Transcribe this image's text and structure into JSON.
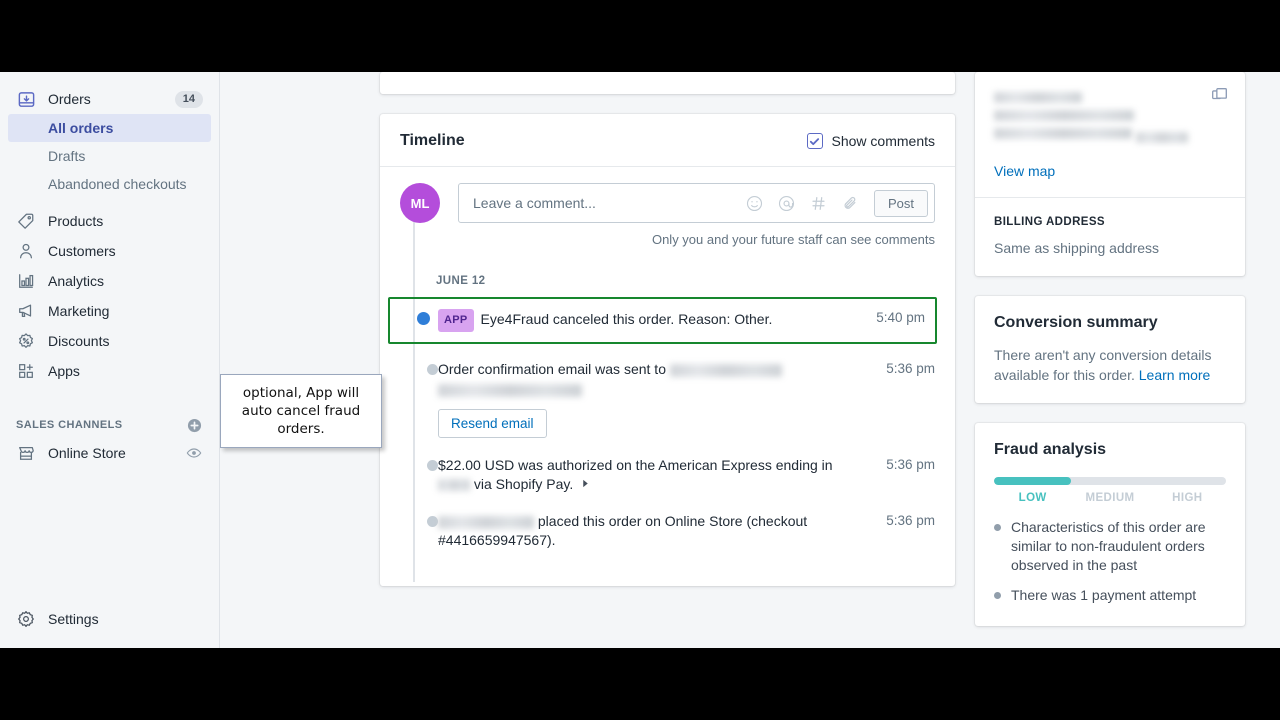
{
  "sidebar": {
    "orders": {
      "label": "Orders",
      "badge": "14",
      "icon": "orders-icon"
    },
    "sub_items": [
      {
        "label": "All orders",
        "active": true
      },
      {
        "label": "Drafts",
        "active": false
      },
      {
        "label": "Abandoned checkouts",
        "active": false
      }
    ],
    "items": [
      {
        "label": "Products",
        "icon": "tag-icon"
      },
      {
        "label": "Customers",
        "icon": "person-icon"
      },
      {
        "label": "Analytics",
        "icon": "bar-chart-icon"
      },
      {
        "label": "Marketing",
        "icon": "megaphone-icon"
      },
      {
        "label": "Discounts",
        "icon": "percent-badge-icon"
      },
      {
        "label": "Apps",
        "icon": "apps-grid-icon"
      }
    ],
    "sales_channels": {
      "label": "SALES CHANNELS",
      "add_icon": "plus-circle-icon",
      "channels": [
        {
          "label": "Online Store",
          "icon": "storefront-icon",
          "trailing_icon": "eye-icon"
        }
      ]
    },
    "settings": {
      "label": "Settings",
      "icon": "gear-icon"
    }
  },
  "timeline": {
    "title": "Timeline",
    "show_comments_label": "Show comments",
    "show_comments_checked": true,
    "avatar_initials": "ML",
    "comment_placeholder": "Leave a comment...",
    "post_label": "Post",
    "privacy_note": "Only you and your future staff can see comments",
    "comment_icons": [
      "emoji-icon",
      "mention-icon",
      "hashtag-icon",
      "attachment-icon"
    ],
    "date_group": "JUNE 12",
    "events": [
      {
        "id": "fraud-cancel",
        "highlighted": true,
        "badge": "APP",
        "text": "Eye4Fraud canceled this order. Reason: Other.",
        "time": "5:40 pm"
      },
      {
        "id": "order-confirmation",
        "highlighted": false,
        "text_before": "Order confirmation email was sent to",
        "redacted": true,
        "button": "Resend email",
        "time": "5:36 pm"
      },
      {
        "id": "payment-authorized",
        "highlighted": false,
        "text_before": "$22.00 USD was authorized on the American Express ending in",
        "text_after": "via Shopify Pay.",
        "redacted": true,
        "time": "5:36 pm"
      },
      {
        "id": "order-placed",
        "highlighted": false,
        "text_after": "placed this order on Online Store (checkout #4416659947567).",
        "redacted": true,
        "time": "5:36 pm"
      }
    ]
  },
  "tooltip": {
    "text": "optional, App will auto cancel fraud orders."
  },
  "right": {
    "shipping": {
      "address_redacted": true,
      "copy_icon": "copy-icon",
      "view_map_label": "View map"
    },
    "billing": {
      "heading": "BILLING ADDRESS",
      "value": "Same as shipping address"
    },
    "conversion": {
      "title": "Conversion summary",
      "body": "There aren't any conversion details available for this order.",
      "link": "Learn more"
    },
    "fraud": {
      "title": "Fraud analysis",
      "level": "LOW",
      "fill_percent": 33,
      "scale": [
        "LOW",
        "MEDIUM",
        "HIGH"
      ],
      "notes": [
        "Characteristics of this order are similar to non-fraudulent orders observed in the past",
        "There was 1 payment attempt"
      ]
    }
  },
  "colors": {
    "accent": "#5c6ac4",
    "link": "#006fbb",
    "highlight_border": "#17872e",
    "app_badge_bg": "#d8a3f0",
    "fraud_low": "#47c1bf",
    "avatar_bg": "#b44ddb",
    "active_dot": "#2f7ed8"
  }
}
